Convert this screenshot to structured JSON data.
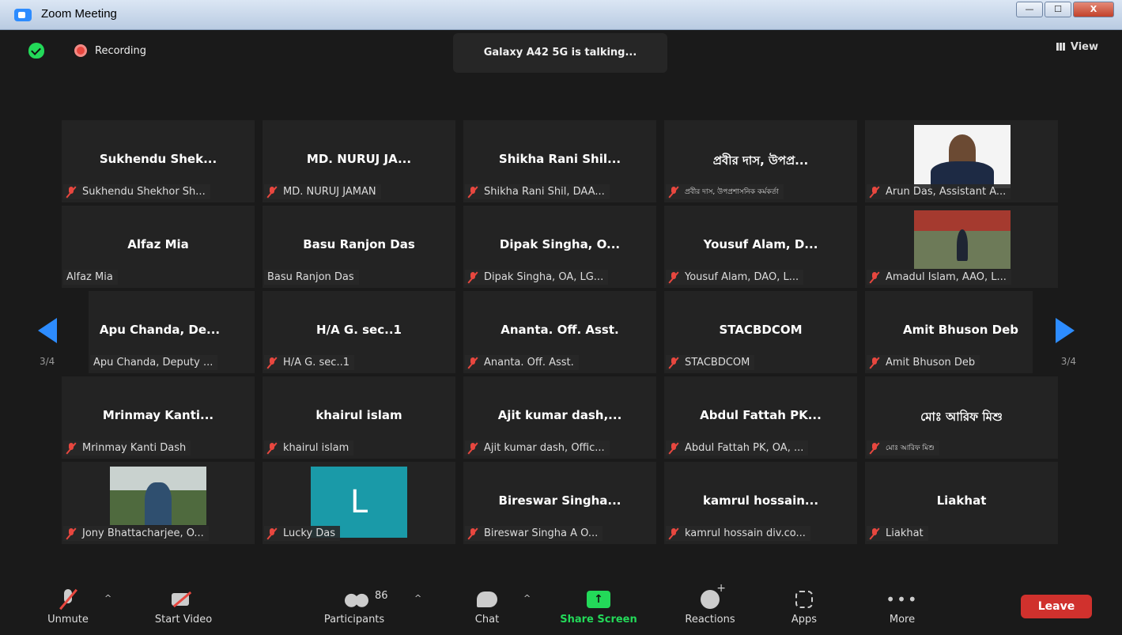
{
  "window": {
    "title": "Zoom Meeting",
    "minimize": "—",
    "maximize": "☐",
    "close": "X"
  },
  "header": {
    "recording": "Recording",
    "talking": "Galaxy A42 5G is talking...",
    "view": "View"
  },
  "pagination": {
    "left_page": "3/4",
    "right_page": "3/4"
  },
  "tiles": [
    {
      "big": "Sukhendu  Shek...",
      "label": "Sukhendu Shekhor Sh...",
      "muted": true
    },
    {
      "big": "MD. NURUJ JA...",
      "label": "MD. NURUJ JAMAN",
      "muted": true
    },
    {
      "big": "Shikha  Rani  Shil...",
      "label": "Shikha Rani Shil, DAA...",
      "muted": true
    },
    {
      "big": "প্রবীর দাস, উপপ্র...",
      "label": "প্রবীর দাস, উপপ্রশাসনিক কর্মকর্তা",
      "muted": true
    },
    {
      "big": "",
      "label": "Arun Das, Assistant A...",
      "muted": true
    },
    {
      "big": "Alfaz Mia",
      "label": "Alfaz Mia",
      "muted": false
    },
    {
      "big": "Basu Ranjon Das",
      "label": "Basu Ranjon Das",
      "muted": false
    },
    {
      "big": "Dipak  Singha,  O...",
      "label": "Dipak Singha, OA, LG...",
      "muted": true
    },
    {
      "big": "Yousuf  Alam,  D...",
      "label": "Yousuf Alam, DAO, L...",
      "muted": true
    },
    {
      "big": "",
      "label": "Amadul Islam, AAO, L...",
      "muted": true
    },
    {
      "big": "Apu  Chanda,  De...",
      "label": "Apu Chanda, Deputy ...",
      "muted": false
    },
    {
      "big": "H/A G. sec..1",
      "label": "H/A G. sec..1",
      "muted": true
    },
    {
      "big": "Ananta. Off. Asst.",
      "label": "Ananta. Off. Asst.",
      "muted": true
    },
    {
      "big": "STACBDCOM",
      "label": "STACBDCOM",
      "muted": true
    },
    {
      "big": "Amit Bhuson Deb",
      "label": "Amit Bhuson Deb",
      "muted": true
    },
    {
      "big": "Mrinmay  Kanti...",
      "label": "Mrinmay Kanti Dash",
      "muted": true
    },
    {
      "big": "khairul islam",
      "label": "khairul islam",
      "muted": true
    },
    {
      "big": "Ajit  kumar  dash,...",
      "label": "Ajit kumar dash, Offic...",
      "muted": true
    },
    {
      "big": "Abdul  Fattah  PK...",
      "label": "Abdul Fattah PK, OA, ...",
      "muted": true
    },
    {
      "big": "মোঃ আরিফ মিশু",
      "label": "মোঃ আরিফ মিশু",
      "muted": true
    },
    {
      "big": "",
      "label": "Jony Bhattacharjee, O...",
      "muted": true
    },
    {
      "big": "",
      "label": "Lucky Das",
      "muted": true,
      "avatar_letter": "L"
    },
    {
      "big": "Bireswar  Singha...",
      "label": "Bireswar Singha   A O...",
      "muted": true
    },
    {
      "big": "kamrul  hossain...",
      "label": "kamrul hossain div.co...",
      "muted": true
    },
    {
      "big": "Liakhat",
      "label": "Liakhat",
      "muted": true
    }
  ],
  "toolbar": {
    "unmute": "Unmute",
    "start_video": "Start Video",
    "participants": "Participants",
    "participants_count": "86",
    "chat": "Chat",
    "share_screen": "Share Screen",
    "reactions": "Reactions",
    "apps": "Apps",
    "more": "More",
    "leave": "Leave",
    "caret": "^"
  },
  "colors": {
    "accent": "#2d8cff",
    "share": "#23d959",
    "leave": "#d0312d",
    "muted": "#e8473f"
  }
}
